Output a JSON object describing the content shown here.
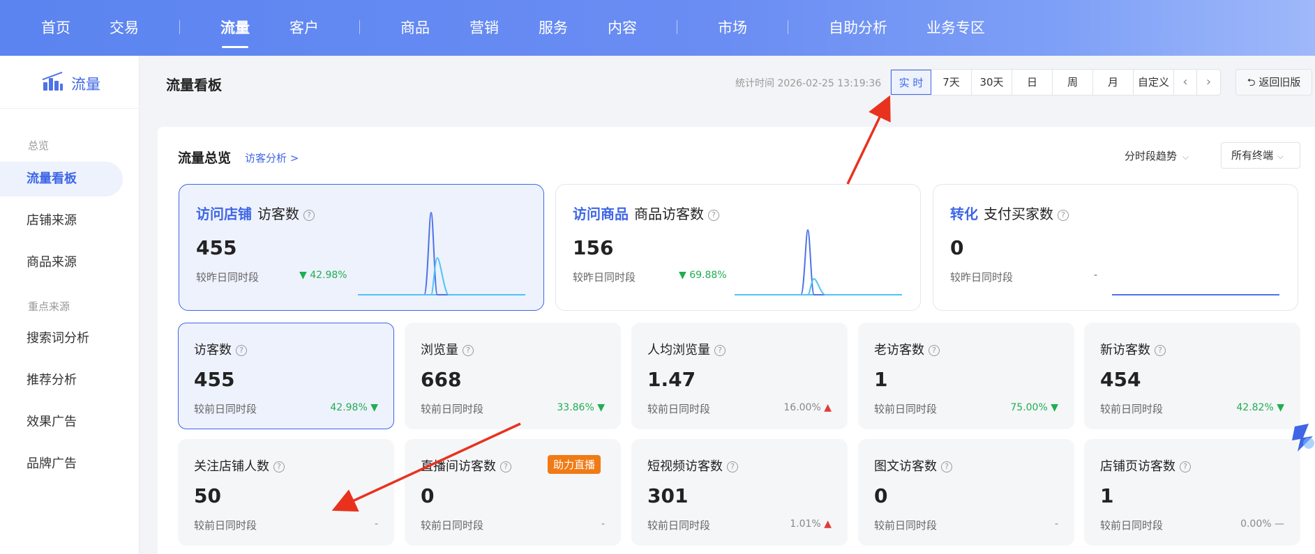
{
  "topnav": {
    "items": [
      "首页",
      "交易",
      "流量",
      "客户",
      "商品",
      "营销",
      "服务",
      "内容",
      "市场",
      "自助分析",
      "业务专区"
    ],
    "active": "流量"
  },
  "sidebar": {
    "title": "流量",
    "group_overview": "总览",
    "items_a": [
      "流量看板",
      "店铺来源",
      "商品来源"
    ],
    "group_key": "重点来源",
    "items_b": [
      "搜索词分析",
      "推荐分析",
      "效果广告",
      "品牌广告"
    ]
  },
  "header": {
    "page_title": "流量看板",
    "stat_time": "统计时间 2026-02-25 13:19:36",
    "time_tabs": [
      "实 时",
      "7天",
      "30天",
      "日",
      "周",
      "月",
      "自定义"
    ],
    "active_tab": "实 时",
    "prev": "‹",
    "next": "›",
    "back_label": "返回旧版"
  },
  "overview": {
    "title": "流量总览",
    "link": "访客分析 >",
    "trend_label": "分时段趋势",
    "terminal_label": "所有终端"
  },
  "big_cards": [
    {
      "category": "访问店铺",
      "metric": "访客数",
      "value": "455",
      "compare": "较昨日同时段",
      "change": "▼ 42.98%",
      "active": true
    },
    {
      "category": "访问商品",
      "metric": "商品访客数",
      "value": "156",
      "compare": "较昨日同时段",
      "change": "▼ 69.88%",
      "active": false
    },
    {
      "category": "转化",
      "metric": "支付买家数",
      "value": "0",
      "compare": "较昨日同时段",
      "change": "-",
      "active": false
    }
  ],
  "small_cards": [
    {
      "label": "访客数",
      "value": "455",
      "compare": "较前日同时段",
      "change": "42.98%",
      "dir": "down"
    },
    {
      "label": "浏览量",
      "value": "668",
      "compare": "较前日同时段",
      "change": "33.86%",
      "dir": "down"
    },
    {
      "label": "人均浏览量",
      "value": "1.47",
      "compare": "较前日同时段",
      "change": "16.00%",
      "dir": "up"
    },
    {
      "label": "老访客数",
      "value": "1",
      "compare": "较前日同时段",
      "change": "75.00%",
      "dir": "down"
    },
    {
      "label": "新访客数",
      "value": "454",
      "compare": "较前日同时段",
      "change": "42.82%",
      "dir": "down"
    },
    {
      "label": "关注店铺人数",
      "value": "50",
      "compare": "较前日同时段",
      "change": "-",
      "dir": "none"
    },
    {
      "label": "直播间访客数",
      "value": "0",
      "compare": "较前日同时段",
      "change": "-",
      "dir": "none",
      "badge": "助力直播"
    },
    {
      "label": "短视频访客数",
      "value": "301",
      "compare": "较前日同时段",
      "change": "1.01%",
      "dir": "up"
    },
    {
      "label": "图文访客数",
      "value": "0",
      "compare": "较前日同时段",
      "change": "-",
      "dir": "none"
    },
    {
      "label": "店铺页访客数",
      "value": "1",
      "compare": "较前日同时段",
      "change": "0.00%",
      "dir": "flat"
    }
  ],
  "colors": {
    "brand": "#3e66e6",
    "nav_gradient_start": "#5b84f0",
    "down_green": "#1fae52",
    "up_red": "#e03a3a",
    "badge_orange": "#f07a15",
    "annotation_red": "#e8321e"
  }
}
